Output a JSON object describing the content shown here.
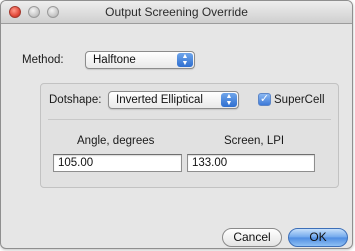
{
  "window": {
    "title": "Output Screening Override"
  },
  "method": {
    "label": "Method:",
    "selected": "Halftone"
  },
  "dotshape": {
    "label": "Dotshape:",
    "selected": "Inverted Elliptical",
    "supercell_label": "SuperCell",
    "supercell_checked": true
  },
  "angle": {
    "header": "Angle, degrees",
    "value": "105.00"
  },
  "screen": {
    "header": "Screen, LPI",
    "value": "133.00"
  },
  "buttons": {
    "cancel": "Cancel",
    "ok": "OK"
  },
  "icons": {
    "popup_arrows": "up-down-arrows-icon",
    "checkmark": "checkmark-icon"
  },
  "colors": {
    "accent": "#3d7ad8",
    "window_bg": "#e6e6e6"
  }
}
